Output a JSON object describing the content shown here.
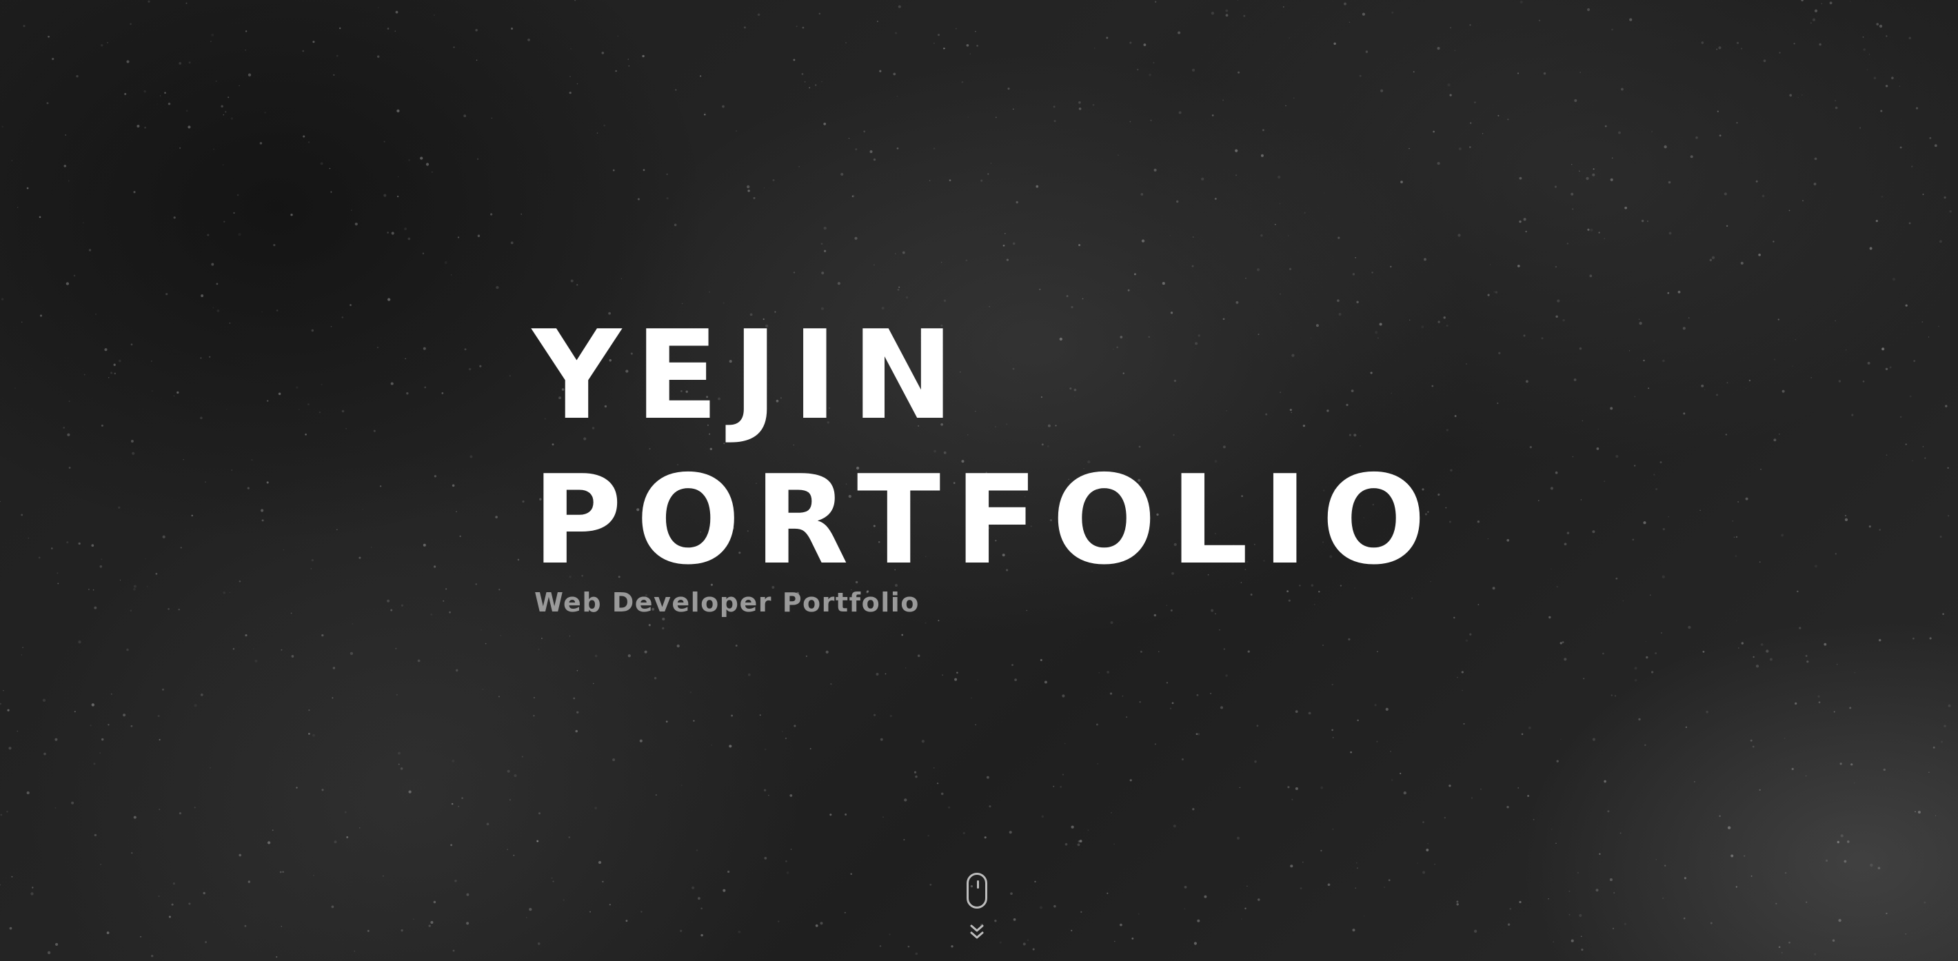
{
  "hero": {
    "title_line1": "YEJIN",
    "title_line2": "PORTFOLIO",
    "subtitle": "Web Developer Portfolio"
  },
  "scroll_indicator": {
    "mouse_icon": "mouse-icon",
    "arrow_icon": "chevron-double-down-icon"
  },
  "colors": {
    "background": "#1c1c1c",
    "title": "#ffffff",
    "subtitle": "#9a9a9a",
    "icon": "#bdbdbd"
  }
}
